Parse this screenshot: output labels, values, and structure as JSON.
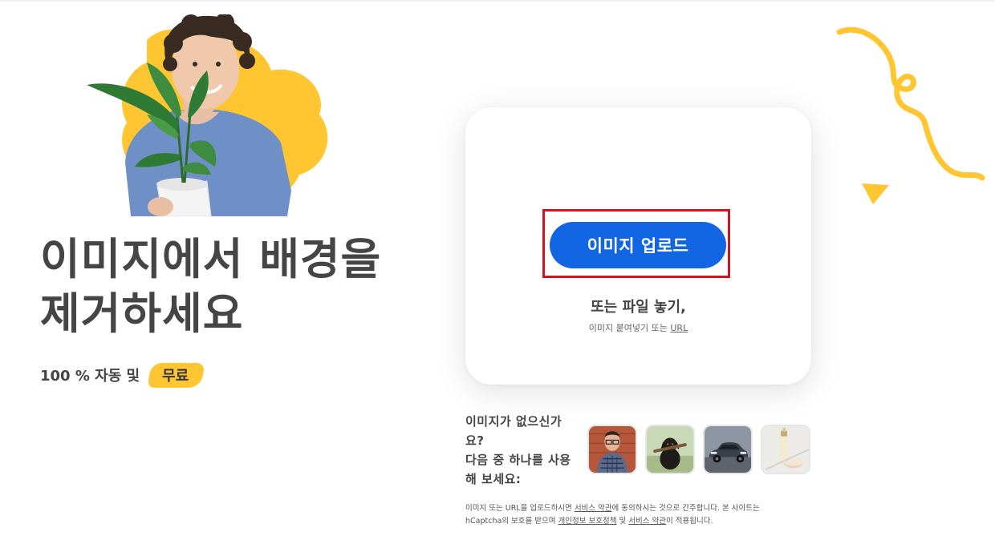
{
  "hero": {
    "headline_line1": "이미지에서 배경을",
    "headline_line2": "제거하세요",
    "sub_text": "100 % 자동 및",
    "free_badge": "무료",
    "image_icon": "person-holding-plant-image"
  },
  "upload_card": {
    "upload_button": "이미지 업로드",
    "drop_text": "또는 파일 놓기,",
    "paste_text": "이미지 붙여넣기 또는",
    "url_link": "URL"
  },
  "samples": {
    "line1": "이미지가 없으신가",
    "line2": "요?",
    "line3": "다음 중 하나를 사용",
    "line4": "해 보세요:",
    "thumbnails": [
      "person-sample",
      "dog-sample",
      "car-sample",
      "product-sample"
    ]
  },
  "terms": {
    "line1_prefix": "이미지 또는 URL을 업로드하시면 ",
    "line1_link": "서비스 약관",
    "line1_suffix": "에 동의하시는 것으로 간주합니다. 본 사이트는",
    "line2_prefix": "hCaptcha의 보호를 받으며 ",
    "line2_link1": "개인정보 보호정책",
    "line2_middle": " 및 ",
    "line2_link2": "서비스 약관",
    "line2_suffix": "이 적용됩니다."
  },
  "colors": {
    "accent_blue": "#1266e4",
    "highlight_yellow": "#ffc632",
    "annotation_red": "#d6121f",
    "text_dark": "#454545"
  }
}
